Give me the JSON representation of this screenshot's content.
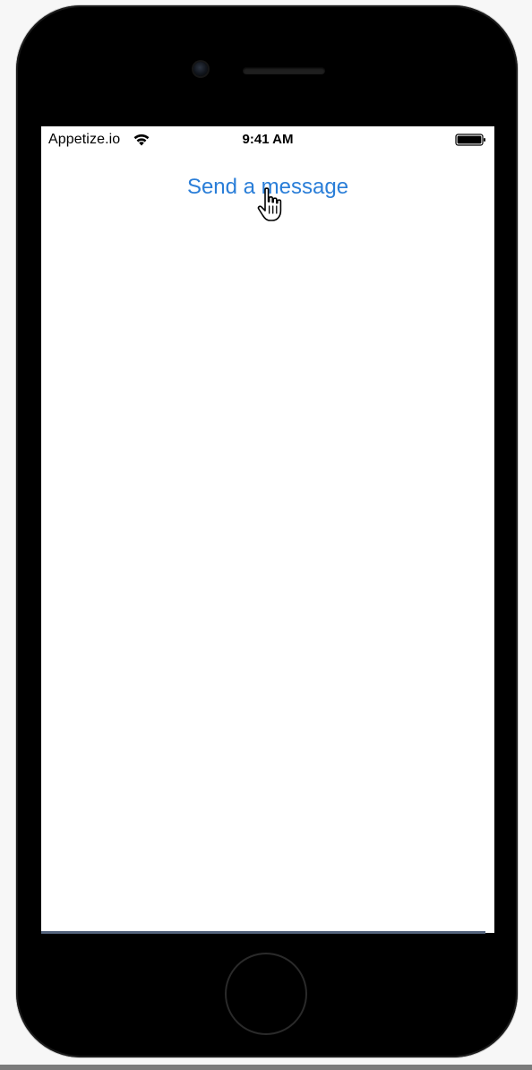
{
  "status_bar": {
    "carrier": "Appetize.io",
    "time": "9:41 AM",
    "wifi_icon": "wifi-icon",
    "battery_icon": "battery-icon",
    "battery_level": 1.0
  },
  "main": {
    "send_button_label": "Send a message"
  },
  "overlay": {
    "cursor_icon": "hand-pointer-icon"
  },
  "colors": {
    "accent": "#2a7ed8",
    "screen_background": "#ffffff",
    "device_body": "#000000"
  }
}
